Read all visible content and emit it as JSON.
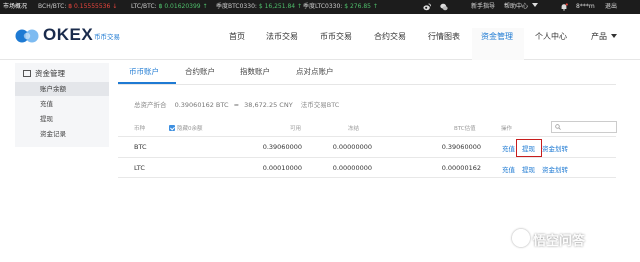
{
  "ticker": {
    "market_label": "市场概况",
    "items": [
      {
        "label": "BCH/BTC:",
        "value": "฿ 0.15555536",
        "dir": "↓"
      },
      {
        "label": "LTC/BTC:",
        "value": "฿ 0.01620399",
        "dir": "↑"
      },
      {
        "label": "季度BTC0330:",
        "value": "$ 16,251.84",
        "dir": "↑"
      },
      {
        "label": "季度LTC0330:",
        "value": "$ 276.85",
        "dir": "↑"
      }
    ],
    "right": {
      "weibo_icon": "weibo-icon",
      "wechat_icon": "wechat-icon",
      "guide_link": "新手指导",
      "help_link": "帮助中心",
      "username": "8***m",
      "logout_link": "退出"
    }
  },
  "header": {
    "logo_text": "OKEX",
    "logo_sub": "币币交易",
    "nav": [
      {
        "label": "首页"
      },
      {
        "label": "法币交易"
      },
      {
        "label": "币币交易"
      },
      {
        "label": "合约交易"
      },
      {
        "label": "行情图表"
      },
      {
        "label": "资金管理"
      },
      {
        "label": "个人中心"
      },
      {
        "label": "产品"
      }
    ]
  },
  "sidebar": {
    "title": "资金管理",
    "items": [
      {
        "label": "账户余额"
      },
      {
        "label": "充值"
      },
      {
        "label": "提现"
      },
      {
        "label": "资金记录"
      }
    ]
  },
  "tabs": [
    {
      "label": "币币账户"
    },
    {
      "label": "合约账户"
    },
    {
      "label": "指数账户"
    },
    {
      "label": "点对点账户"
    }
  ],
  "summary": {
    "label": "总资产折合",
    "btc": "0.39060162 BTC",
    "approx": "≈",
    "cny": "38,672.25 CNY",
    "link": "法币交易BTC"
  },
  "table": {
    "headers": {
      "coin": "币种",
      "hide_zero": "隐藏0余额",
      "available": "可用",
      "frozen": "冻结",
      "btc_value": "BTC估值",
      "actions": "操作"
    },
    "search_placeholder": "",
    "rows": [
      {
        "coin": "BTC",
        "available": "0.39060000",
        "frozen": "0.00000000",
        "btc_value": "0.39060000",
        "deposit": "充值",
        "withdraw": "提现",
        "transfer": "资金划转"
      },
      {
        "coin": "LTC",
        "available": "0.00010000",
        "frozen": "0.00000000",
        "btc_value": "0.00000162",
        "deposit": "充值",
        "withdraw": "提现",
        "transfer": "资金划转"
      }
    ]
  },
  "watermark": {
    "text": "悟空问答"
  },
  "colors": {
    "accent": "#1e7ad3",
    "highlight_box": "#c81d1d",
    "ticker_bg": "#1c1c1c",
    "down": "#e8453c",
    "up": "#4fbf6b"
  }
}
